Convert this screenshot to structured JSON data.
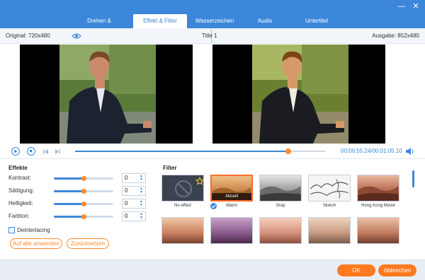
{
  "tabs": [
    {
      "label": "Drehen & Zuschneiden"
    },
    {
      "label": "Effekt & Filter"
    },
    {
      "label": "Wasserzeichen"
    },
    {
      "label": "Audio"
    },
    {
      "label": "Untertitel"
    }
  ],
  "active_tab": "Effekt & Filter",
  "header": {
    "original": "Original: 720x480",
    "title": "Title 1",
    "ausgabe": "Ausgabe: 852x480"
  },
  "playback": {
    "time": "00:00:55.24/00:01:05.10",
    "progress_fraction": 0.85
  },
  "effects": {
    "title": "Effekte",
    "rows": [
      {
        "label": "Kontrast:",
        "value": "0",
        "level": 0.5
      },
      {
        "label": "Sättigung:",
        "value": "0",
        "level": 0.5
      },
      {
        "label": "Helligkeit:",
        "value": "0",
        "level": 0.5
      },
      {
        "label": "Farbton:",
        "value": "0",
        "level": 0.5
      }
    ],
    "deinterlacing": "Deinterlacing",
    "apply_all": "Auf alle anwenden",
    "reset": "Zurücksetzen"
  },
  "filter": {
    "title": "Filter",
    "items": [
      {
        "label": "No effect"
      },
      {
        "label": "Warm",
        "badge": "Aktuell"
      },
      {
        "label": "Gray"
      },
      {
        "label": "Sketch"
      },
      {
        "label": "Hong Kong Movie"
      },
      {
        "label": ""
      },
      {
        "label": ""
      },
      {
        "label": ""
      },
      {
        "label": ""
      },
      {
        "label": ""
      }
    ]
  },
  "footer": {
    "ok": "OK",
    "cancel": "Abbrechen"
  },
  "colors": {
    "accent": "#3c87d9",
    "orange": "#ff7a1f"
  }
}
